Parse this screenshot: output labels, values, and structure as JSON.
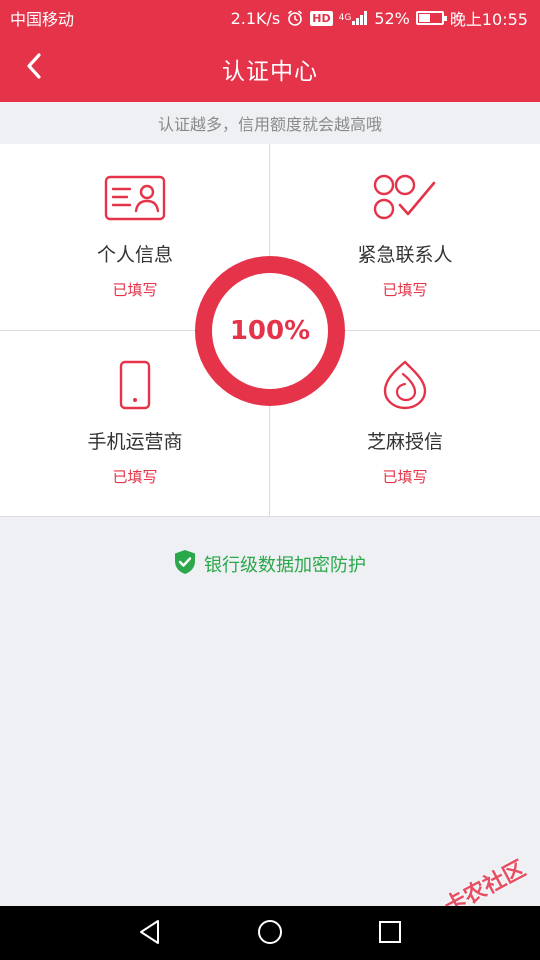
{
  "status_bar": {
    "carrier": "中国移动",
    "net_speed": "2.1K/s",
    "hd": "HD",
    "network": "4G",
    "battery_percent_text": "52%",
    "battery_level": 0.52,
    "time": "晚上10:55"
  },
  "nav": {
    "title": "认证中心"
  },
  "hint": "认证越多，信用额度就会越高哦",
  "cards": [
    {
      "label": "个人信息",
      "status": "已填写",
      "icon": "id-card-icon"
    },
    {
      "label": "紧急联系人",
      "status": "已填写",
      "icon": "contacts-check-icon"
    },
    {
      "label": "手机运营商",
      "status": "已填写",
      "icon": "phone-icon"
    },
    {
      "label": "芝麻授信",
      "status": "已填写",
      "icon": "sesame-icon"
    }
  ],
  "progress": {
    "text": "100%",
    "value": 1.0
  },
  "security_notice": "银行级数据加密防护",
  "watermark": "卡农社区",
  "colors": {
    "accent": "#e5334a",
    "secure_green": "#2aa84a",
    "background": "#eef0f3"
  }
}
